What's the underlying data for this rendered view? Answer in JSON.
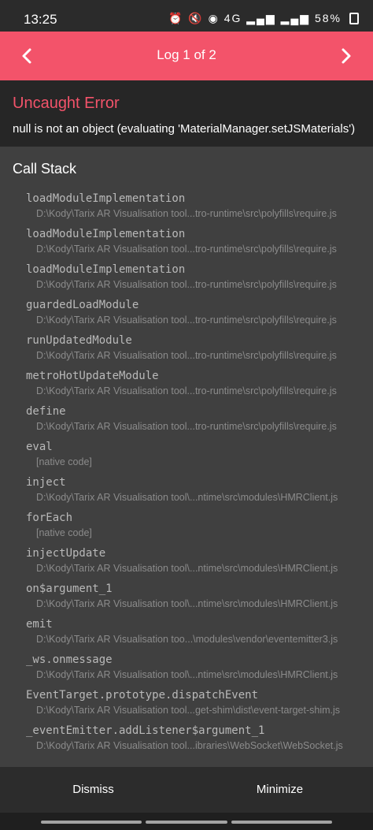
{
  "status": {
    "time": "13:25",
    "battery": "58%",
    "icons_text": "⏰ 🔇 ◉ 4G ▂▄▆ ▂▄▆"
  },
  "header": {
    "title": "Log 1 of 2"
  },
  "error": {
    "title": "Uncaught Error",
    "message": "null is not an object (evaluating 'MaterialManager.setJSMaterials')"
  },
  "call_stack": {
    "heading": "Call Stack",
    "frames": [
      {
        "name": "loadModuleImplementation",
        "file": "D:\\Kody\\Tarix AR Visualisation tool...tro-runtime\\src\\polyfills\\require.js"
      },
      {
        "name": "loadModuleImplementation",
        "file": "D:\\Kody\\Tarix AR Visualisation tool...tro-runtime\\src\\polyfills\\require.js"
      },
      {
        "name": "loadModuleImplementation",
        "file": "D:\\Kody\\Tarix AR Visualisation tool...tro-runtime\\src\\polyfills\\require.js"
      },
      {
        "name": "guardedLoadModule",
        "file": "D:\\Kody\\Tarix AR Visualisation tool...tro-runtime\\src\\polyfills\\require.js"
      },
      {
        "name": "runUpdatedModule",
        "file": "D:\\Kody\\Tarix AR Visualisation tool...tro-runtime\\src\\polyfills\\require.js"
      },
      {
        "name": "metroHotUpdateModule",
        "file": "D:\\Kody\\Tarix AR Visualisation tool...tro-runtime\\src\\polyfills\\require.js"
      },
      {
        "name": "define",
        "file": "D:\\Kody\\Tarix AR Visualisation tool...tro-runtime\\src\\polyfills\\require.js"
      },
      {
        "name": "eval",
        "file": "[native code]"
      },
      {
        "name": "inject",
        "file": "D:\\Kody\\Tarix AR Visualisation tool\\...ntime\\src\\modules\\HMRClient.js"
      },
      {
        "name": "forEach",
        "file": "[native code]"
      },
      {
        "name": "injectUpdate",
        "file": "D:\\Kody\\Tarix AR Visualisation tool\\...ntime\\src\\modules\\HMRClient.js"
      },
      {
        "name": "on$argument_1",
        "file": "D:\\Kody\\Tarix AR Visualisation tool\\...ntime\\src\\modules\\HMRClient.js"
      },
      {
        "name": "emit",
        "file": "D:\\Kody\\Tarix AR Visualisation too...\\modules\\vendor\\eventemitter3.js"
      },
      {
        "name": "_ws.onmessage",
        "file": "D:\\Kody\\Tarix AR Visualisation tool\\...ntime\\src\\modules\\HMRClient.js"
      },
      {
        "name": "EventTarget.prototype.dispatchEvent",
        "file": "D:\\Kody\\Tarix AR Visualisation tool...get-shim\\dist\\event-target-shim.js"
      },
      {
        "name": "_eventEmitter.addListener$argument_1",
        "file": "D:\\Kody\\Tarix AR Visualisation tool...ibraries\\WebSocket\\WebSocket.js"
      }
    ]
  },
  "footer": {
    "dismiss_label": "Dismiss",
    "minimize_label": "Minimize"
  },
  "colors": {
    "accent": "#f3536a",
    "stack_bg": "#404040",
    "header_bg": "#f3536a"
  },
  "icons": {
    "prev": "chevron-left-icon",
    "next": "chevron-right-icon"
  }
}
